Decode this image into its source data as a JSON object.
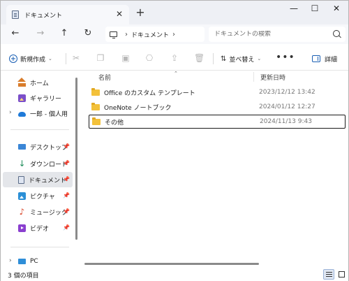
{
  "window": {
    "tab_title": "ドキュメント",
    "tab_close": "✕",
    "tab_add": "+",
    "minimize": "—",
    "maximize": "☐",
    "close": "✕"
  },
  "addressbar": {
    "back": "←",
    "forward": "→",
    "up": "↑",
    "refresh": "↻",
    "breadcrumb": [
      "ドキュメント"
    ],
    "search_placeholder": "ドキュメントの検索"
  },
  "commandbar": {
    "new_label": "新規作成",
    "sort_label": "並べ替え",
    "more_label": "•••",
    "details_label": "詳細",
    "icons": [
      "cut-icon",
      "copy-icon",
      "paste-icon",
      "rename-icon",
      "share-icon",
      "delete-icon"
    ]
  },
  "sidebar": {
    "items": [
      {
        "label": "ホーム",
        "icon": "home-icon"
      },
      {
        "label": "ギャラリー",
        "icon": "gallery-icon"
      },
      {
        "label": "一郎 - 個人用",
        "icon": "onedrive-cloud-icon"
      },
      {
        "label": "デスクトップ",
        "icon": "desktop-icon"
      },
      {
        "label": "ダウンロード",
        "icon": "download-icon"
      },
      {
        "label": "ドキュメント",
        "icon": "documents-icon"
      },
      {
        "label": "ピクチャ",
        "icon": "pictures-icon"
      },
      {
        "label": "ミュージック",
        "icon": "music-icon"
      },
      {
        "label": "ビデオ",
        "icon": "videos-icon"
      },
      {
        "label": "PC",
        "icon": "pc-icon"
      }
    ]
  },
  "content": {
    "columns": {
      "name": "名前",
      "modified": "更新日時"
    },
    "rows": [
      {
        "name": "Office のカスタム テンプレート",
        "modified": "2023/12/12 13:42"
      },
      {
        "name": "OneNote ノートブック",
        "modified": "2024/01/12 12:27"
      },
      {
        "name": "その他",
        "modified": "2024/11/13 9:43"
      }
    ]
  },
  "statusbar": {
    "item_count": "3 個の項目"
  },
  "colors": {
    "accent": "#1a5fb4",
    "folder": "#f3c13a",
    "selection": "#e4e6ea"
  }
}
